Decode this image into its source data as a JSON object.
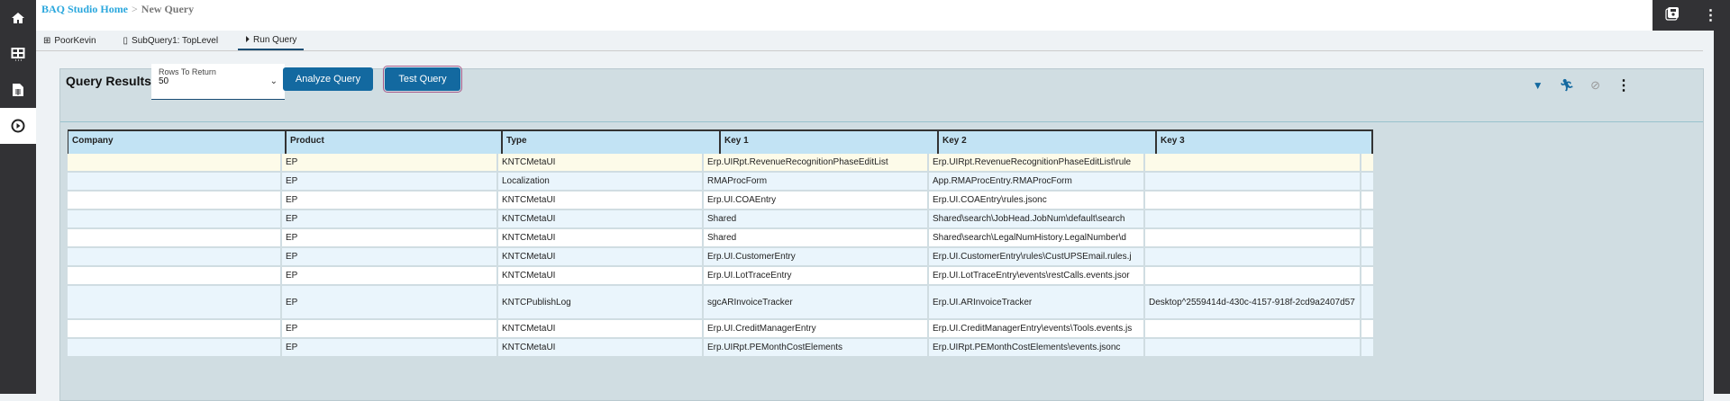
{
  "breadcrumb": {
    "home": "BAQ Studio Home",
    "separator": ">",
    "current": "New Query"
  },
  "tabs": [
    {
      "label": "PoorKevin",
      "icon": "table-icon"
    },
    {
      "label": "SubQuery1: TopLevel",
      "icon": "document-icon"
    },
    {
      "label": "Run Query",
      "icon": "play-circle-icon",
      "active": true
    }
  ],
  "panel": {
    "title": "Query Results",
    "rows_to_return": {
      "label": "Rows To Return",
      "value": "50"
    },
    "analyze_label": "Analyze Query",
    "test_label": "Test Query"
  },
  "table": {
    "columns": [
      "Company",
      "Product",
      "Type",
      "Key 1",
      "Key 2",
      "Key 3"
    ],
    "rows": [
      [
        "",
        "EP",
        "KNTCMetaUI",
        "Erp.UIRpt.RevenueRecognitionPhaseEditList",
        "Erp.UIRpt.RevenueRecognitionPhaseEditList\\rule",
        ""
      ],
      [
        "",
        "EP",
        "Localization",
        "RMAProcForm",
        "App.RMAProcEntry.RMAProcForm",
        ""
      ],
      [
        "",
        "EP",
        "KNTCMetaUI",
        "Erp.UI.COAEntry",
        "Erp.UI.COAEntry\\rules.jsonc",
        ""
      ],
      [
        "",
        "EP",
        "KNTCMetaUI",
        "Shared",
        "Shared\\search\\JobHead.JobNum\\default\\search",
        ""
      ],
      [
        "",
        "EP",
        "KNTCMetaUI",
        "Shared",
        "Shared\\search\\LegalNumHistory.LegalNumber\\d",
        ""
      ],
      [
        "",
        "EP",
        "KNTCMetaUI",
        "Erp.UI.CustomerEntry",
        "Erp.UI.CustomerEntry\\rules\\CustUPSEmail.rules.j",
        ""
      ],
      [
        "",
        "EP",
        "KNTCMetaUI",
        "Erp.UI.LotTraceEntry",
        "Erp.UI.LotTraceEntry\\events\\restCalls.events.jsor",
        ""
      ],
      [
        "",
        "EP",
        "KNTCPublishLog",
        "sgcARInvoiceTracker",
        "Erp.UI.ARInvoiceTracker",
        "Desktop^2559414d-430c-4157-918f-2cd9a2407d57"
      ],
      [
        "",
        "EP",
        "KNTCMetaUI",
        "Erp.UI.CreditManagerEntry",
        "Erp.UI.CreditManagerEntry\\events\\Tools.events.js",
        ""
      ],
      [
        "",
        "EP",
        "KNTCMetaUI",
        "Erp.UIRpt.PEMonthCostElements",
        "Erp.UIRpt.PEMonthCostElements\\events.jsonc",
        ""
      ]
    ]
  }
}
